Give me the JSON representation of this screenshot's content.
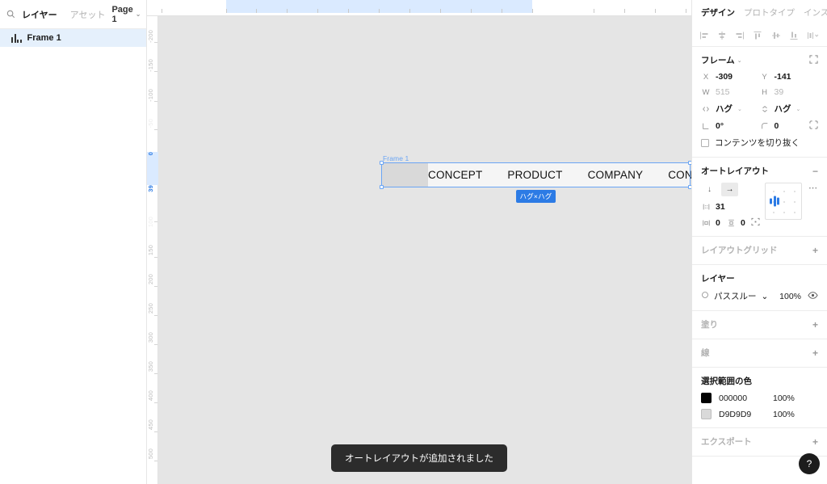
{
  "left_panel": {
    "search_icon": "search-icon",
    "tabs": [
      {
        "label": "レイヤー",
        "active": true
      },
      {
        "label": "アセット",
        "active": false
      }
    ],
    "page_selector": {
      "label": "Page 1",
      "chevron": "⌄"
    },
    "layers": [
      {
        "name": "Frame 1",
        "icon": "auto-layout-icon",
        "selected": true
      }
    ]
  },
  "canvas": {
    "ruler_left_labels": [
      "-200",
      "-150",
      "-100",
      "-50",
      "0",
      "39",
      "100",
      "150",
      "200",
      "250",
      "300",
      "350",
      "400",
      "450",
      "500"
    ],
    "ruler_highlight_label_top": "0",
    "ruler_highlight_label_bottom": "39",
    "frame": {
      "name": "Frame 1",
      "rect_color": "#D9D9D9",
      "background": "#F5F5F5",
      "nav_items": [
        "CONCEPT",
        "PRODUCT",
        "COMPANY",
        "CONTACT"
      ],
      "size_badge": "ハグ×ハグ"
    },
    "toast": "オートレイアウトが追加されました"
  },
  "right_panel": {
    "tabs": [
      {
        "label": "デザイン",
        "active": true
      },
      {
        "label": "プロトタイプ",
        "active": false
      },
      {
        "label": "インスペクト",
        "active": false
      }
    ],
    "align_icons": [
      "align-left-icon",
      "align-horizontal-center-icon",
      "align-right-icon",
      "align-top-icon",
      "align-vertical-center-icon",
      "align-bottom-icon",
      "distribute-icon"
    ],
    "frame_section": {
      "title": "フレーム",
      "chevron": "⌄",
      "expand_icon": "collapse-icon",
      "x": {
        "label": "X",
        "value": "-309"
      },
      "y": {
        "label": "Y",
        "value": "-141"
      },
      "w": {
        "label": "W",
        "value": "515"
      },
      "h": {
        "label": "H",
        "value": "39"
      },
      "resize_w": {
        "label": "ハグ",
        "chevron": "⌄"
      },
      "resize_h": {
        "label": "ハグ",
        "chevron": "⌄"
      },
      "rotation": "0°",
      "corner_radius": "0",
      "independent_corners_icon": "independent-corners-icon",
      "clip_content": {
        "label": "コンテンツを切り抜く",
        "checked": false
      }
    },
    "autolayout_section": {
      "title": "オートレイアウト",
      "remove_label": "−",
      "direction_vertical": "↓",
      "direction_horizontal": "→",
      "direction_selected": "horizontal",
      "gap": "31",
      "padding_horizontal": "0",
      "padding_vertical": "0",
      "more_label": "⋯",
      "advanced_icon": "advanced-layout-icon"
    },
    "layout_grid_section": {
      "title": "レイアウトグリッド",
      "add_label": "+"
    },
    "layer_section": {
      "title": "レイヤー",
      "blend_mode": "パススルー",
      "blend_chevron": "⌄",
      "opacity": "100%",
      "visibility_icon": "eye-icon"
    },
    "fill_section": {
      "title": "塗り",
      "add_label": "+"
    },
    "stroke_section": {
      "title": "線",
      "add_label": "+"
    },
    "selection_colors_section": {
      "title": "選択範囲の色",
      "colors": [
        {
          "swatch": "#000000",
          "hex": "000000",
          "opacity": "100%"
        },
        {
          "swatch": "#D9D9D9",
          "hex": "D9D9D9",
          "opacity": "100%"
        }
      ]
    },
    "export_section": {
      "title": "エクスポート",
      "add_label": "+"
    },
    "help_button": "?"
  }
}
